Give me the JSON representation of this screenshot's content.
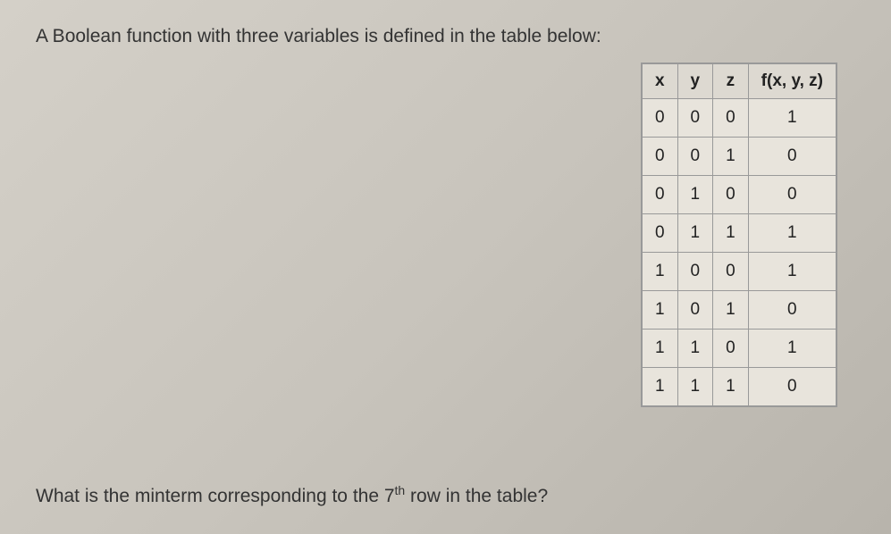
{
  "intro": "A Boolean function with three variables is defined in the table below:",
  "table": {
    "headers": [
      "x",
      "y",
      "z",
      "f(x, y, z)"
    ],
    "rows": [
      [
        "0",
        "0",
        "0",
        "1"
      ],
      [
        "0",
        "0",
        "1",
        "0"
      ],
      [
        "0",
        "1",
        "0",
        "0"
      ],
      [
        "0",
        "1",
        "1",
        "1"
      ],
      [
        "1",
        "0",
        "0",
        "1"
      ],
      [
        "1",
        "0",
        "1",
        "0"
      ],
      [
        "1",
        "1",
        "0",
        "1"
      ],
      [
        "1",
        "1",
        "1",
        "0"
      ]
    ]
  },
  "question": {
    "prefix": "What is the minterm corresponding to the 7",
    "sup": "th",
    "suffix": " row in the table?"
  }
}
